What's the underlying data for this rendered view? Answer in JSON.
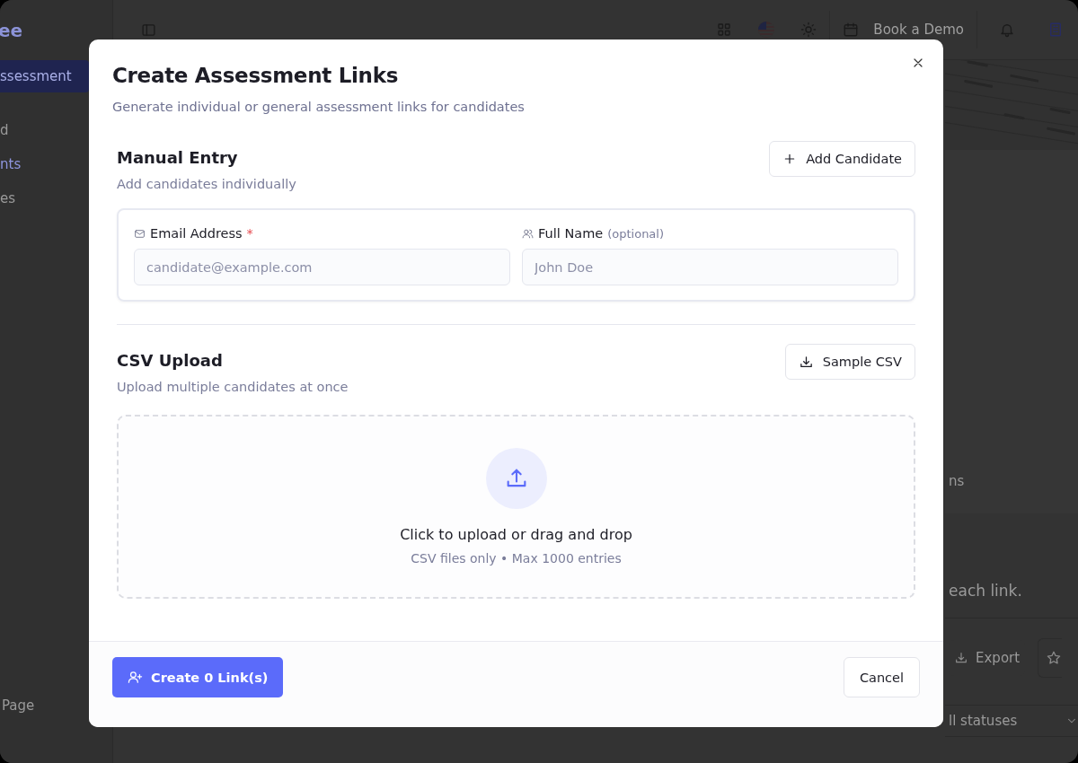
{
  "app": {
    "logo": "ee",
    "sidebar": {
      "action": "ssessment",
      "items": [
        {
          "label": "d",
          "selected": false
        },
        {
          "label": "nts",
          "selected": true
        },
        {
          "label": "es",
          "selected": false
        }
      ],
      "footer": "Page"
    },
    "topbar": {
      "demo_button": "Book a Demo"
    },
    "main": {
      "card_text": "ns",
      "note": "each link.",
      "export_button": "Export",
      "status_filter": "ll statuses"
    }
  },
  "modal": {
    "title": "Create Assessment Links",
    "subtitle": "Generate individual or general assessment links for candidates",
    "sections": [
      {
        "kind": "manual",
        "title": "Manual Entry",
        "description": "Add candidates individually",
        "button": "Add Candidate",
        "fields": [
          {
            "kind": "email",
            "label": "Email Address",
            "required_mark": "*",
            "placeholder": "candidate@example.com"
          },
          {
            "kind": "name",
            "label": "Full Name",
            "hint": "(optional)",
            "placeholder": "John Doe"
          }
        ]
      },
      {
        "kind": "csv",
        "title": "CSV Upload",
        "description": "Upload multiple candidates at once",
        "button": "Sample CSV",
        "dropzone": {
          "text": "Click to upload or drag and drop",
          "subtext": "CSV files only • Max 1000 entries"
        }
      }
    ],
    "primary_button": "Create 0 Link(s)",
    "cancel_button": "Cancel"
  }
}
